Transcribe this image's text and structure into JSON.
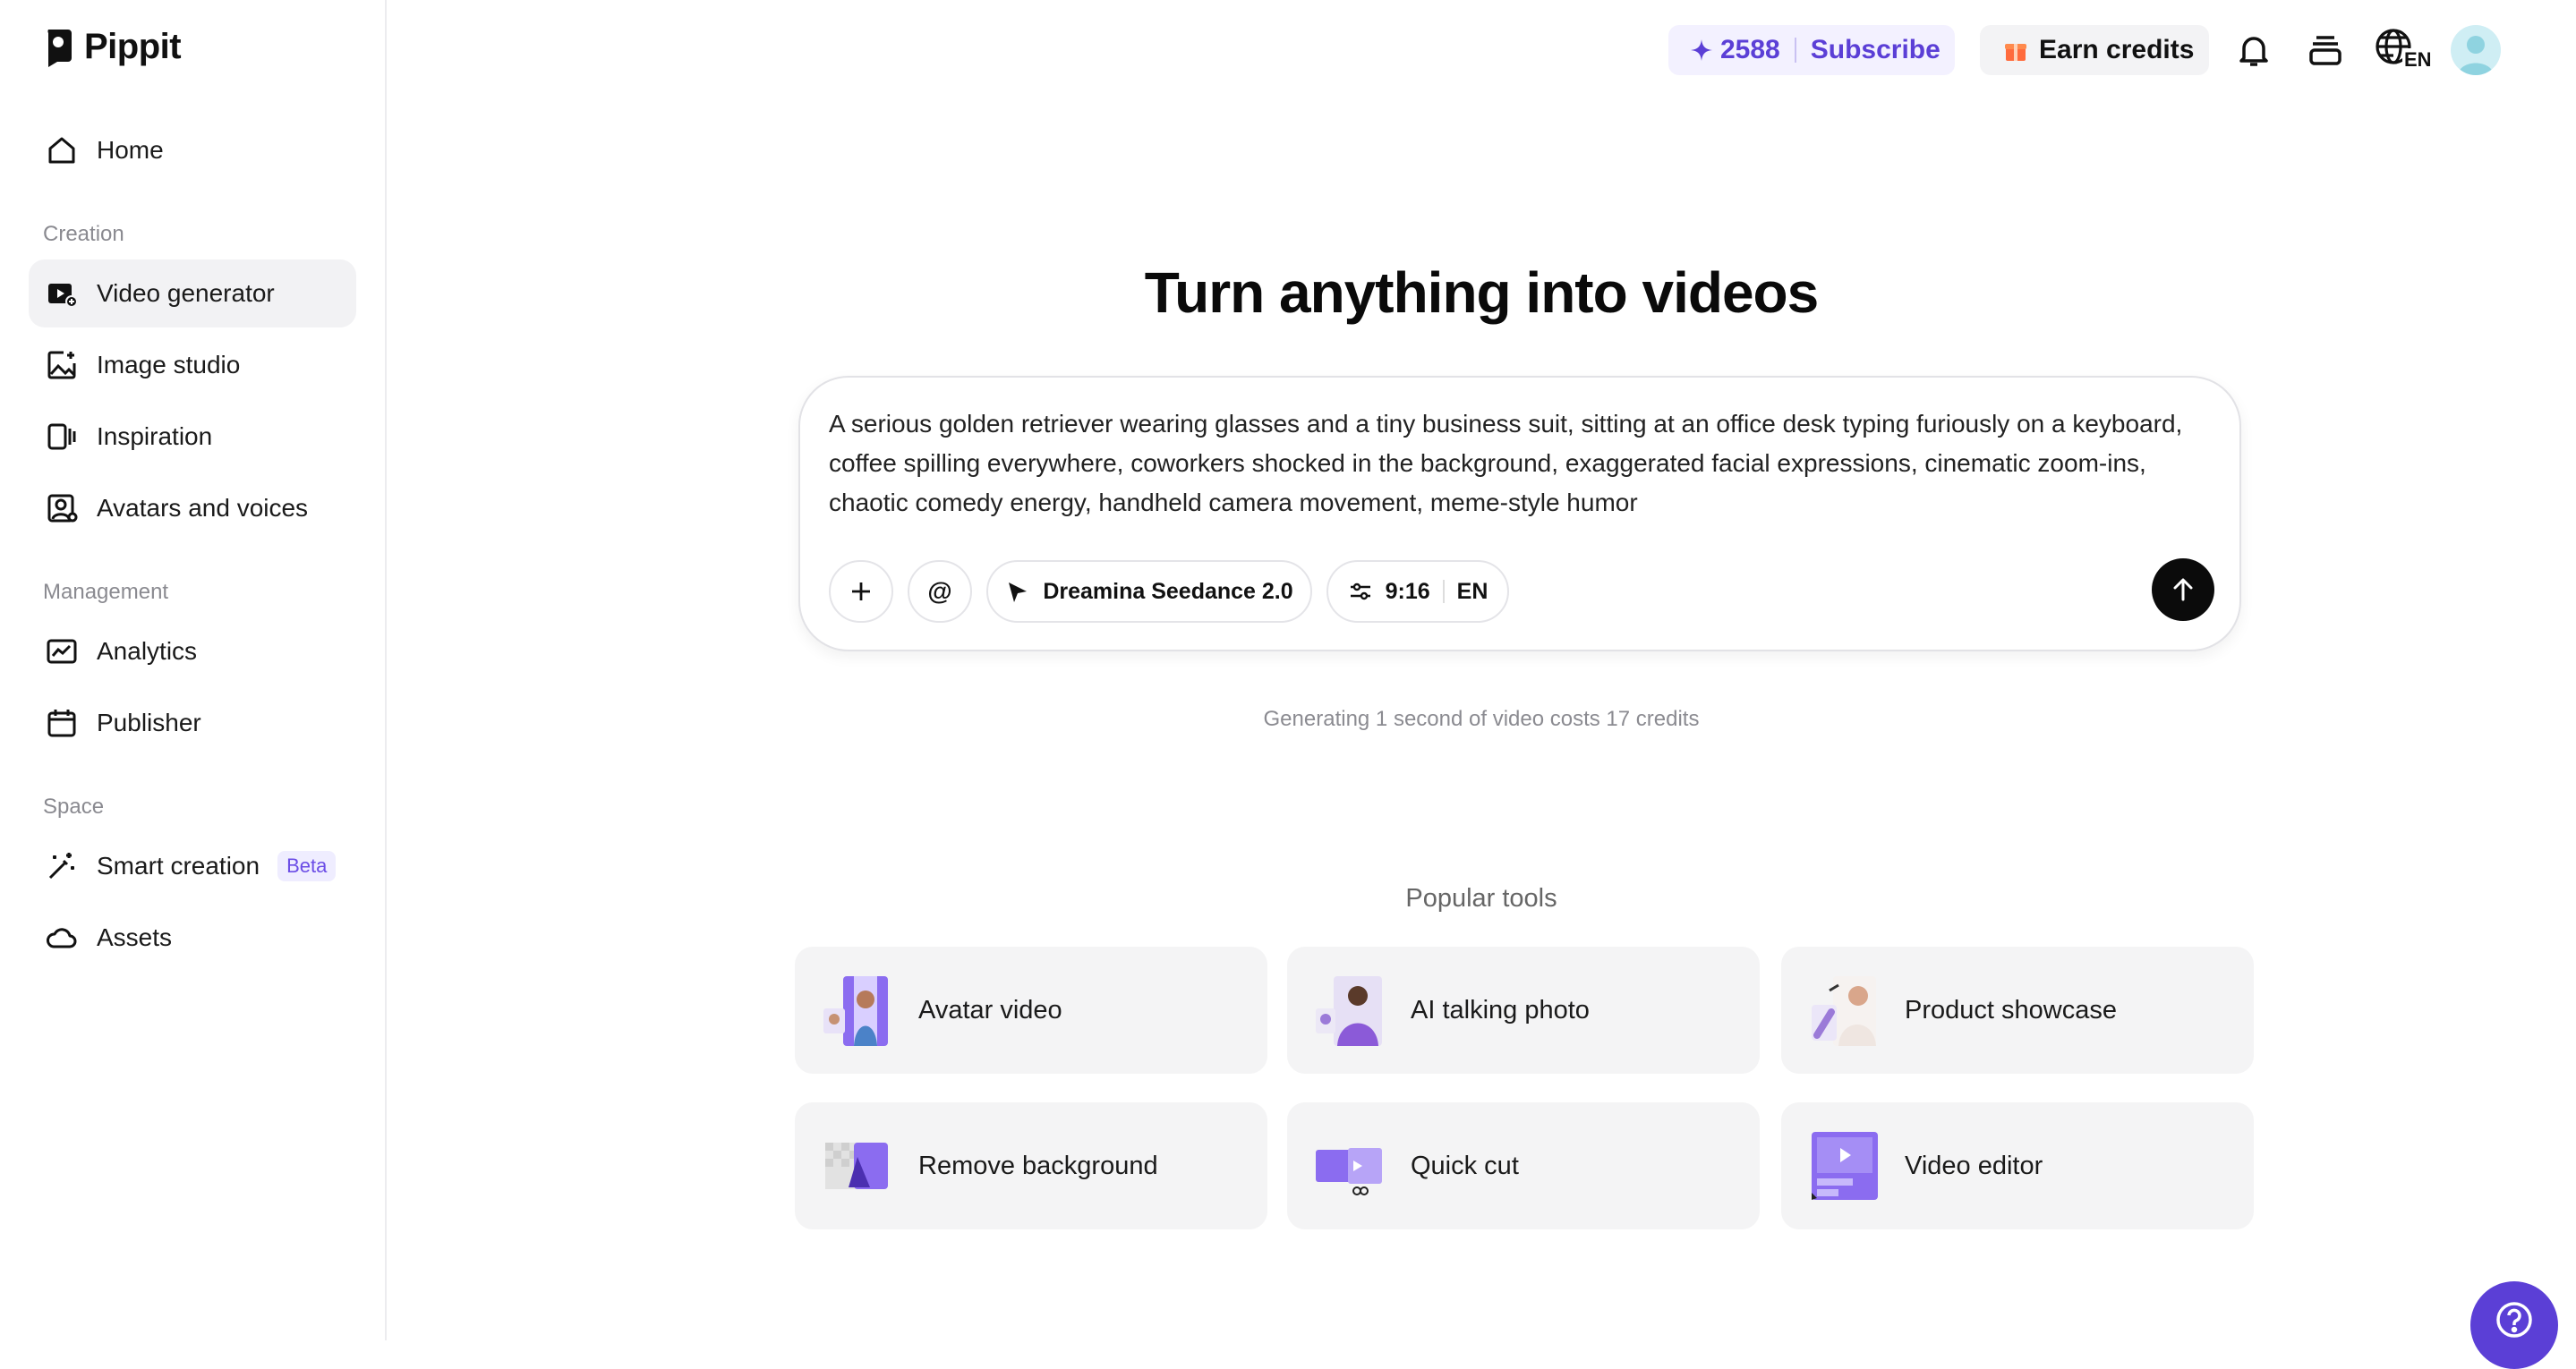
{
  "brand": {
    "name": "Pippit"
  },
  "sidebar": {
    "home_label": "Home",
    "section_creation": "Creation",
    "section_management": "Management",
    "section_space": "Space",
    "items": [
      {
        "label": "Video generator",
        "icon": "video-plus-icon"
      },
      {
        "label": "Image studio",
        "icon": "image-plus-icon"
      },
      {
        "label": "Inspiration",
        "icon": "inspiration-icon"
      },
      {
        "label": "Avatars and voices",
        "icon": "avatar-icon"
      },
      {
        "label": "Analytics",
        "icon": "analytics-icon"
      },
      {
        "label": "Publisher",
        "icon": "calendar-icon"
      },
      {
        "label": "Smart creation",
        "icon": "magic-wand-icon",
        "badge": "Beta"
      },
      {
        "label": "Assets",
        "icon": "cloud-icon"
      }
    ]
  },
  "topbar": {
    "credits": "2588",
    "subscribe_label": "Subscribe",
    "earn_label": "Earn credits",
    "language": "EN"
  },
  "main": {
    "headline": "Turn anything into videos",
    "prompt_text": "A serious golden retriever wearing glasses and a tiny business suit, sitting at an office desk typing furiously on a keyboard, coffee spilling everywhere, coworkers shocked in the background, exaggerated facial expressions, cinematic zoom-ins, chaotic comedy energy, handheld camera movement, meme-style humor",
    "model_label": "Dreamina Seedance 2.0",
    "aspect_label": "9:16",
    "lang_label": "EN",
    "mention_label": "@",
    "cost_note": "Generating 1 second of video costs 17 credits",
    "popular_title": "Popular tools",
    "tools": [
      {
        "label": "Avatar video"
      },
      {
        "label": "AI talking photo"
      },
      {
        "label": "Product showcase"
      },
      {
        "label": "Remove background"
      },
      {
        "label": "Quick cut"
      },
      {
        "label": "Video editor"
      }
    ]
  },
  "colors": {
    "accent": "#5b3fd6",
    "accent_bg": "#f3f1ff",
    "card_bg": "#f4f4f5"
  }
}
